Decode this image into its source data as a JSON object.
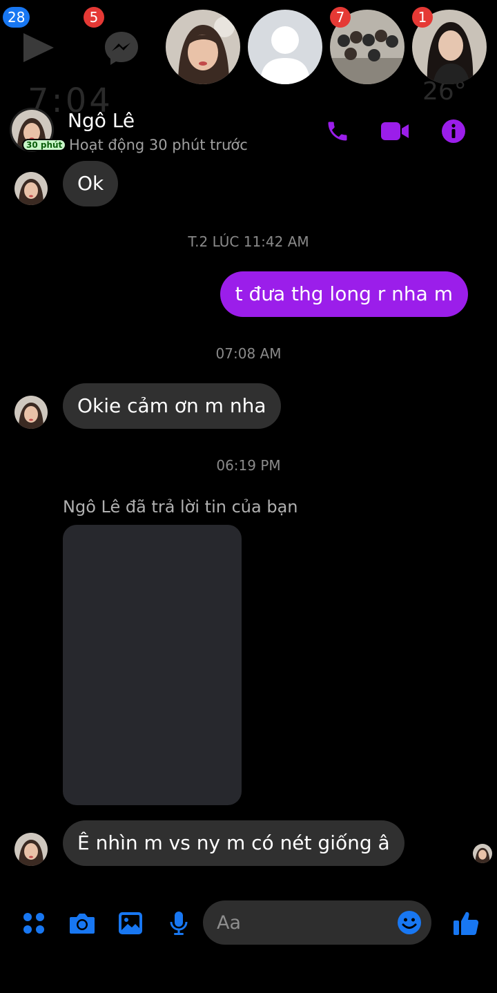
{
  "top_bar": {
    "badges": {
      "play": "28",
      "messenger": "5",
      "group": "7",
      "last": "1"
    },
    "ghost_time": "7:04",
    "ghost_temp": "26°"
  },
  "header": {
    "name": "Ngô Lê",
    "status": "Hoạt động 30 phút trước",
    "active_pill": "30 phút"
  },
  "messages": [
    {
      "type": "in",
      "text": "Ok"
    },
    {
      "type": "time",
      "text": "T.2 LÚC 11:42 AM"
    },
    {
      "type": "out",
      "text": "t đưa thg long r nha m"
    },
    {
      "type": "time",
      "text": "07:08 AM"
    },
    {
      "type": "in",
      "text": "Okie cảm ơn m nha"
    },
    {
      "type": "time",
      "text": "06:19 PM"
    },
    {
      "type": "reply_note",
      "text": "Ngô Lê đã trả lời tin của bạn"
    },
    {
      "type": "in",
      "text": "Ê nhìn m vs ny m có nét giống â"
    }
  ],
  "composer": {
    "placeholder": "Aa"
  },
  "colors": {
    "accent": "#9b1eea",
    "blue": "#1877f2",
    "bubble_in": "#303030",
    "badge_red": "#e53935"
  },
  "icons": [
    "play-icon",
    "messenger-icon",
    "phone-icon",
    "video-icon",
    "info-icon",
    "apps-icon",
    "camera-icon",
    "gallery-icon",
    "mic-icon",
    "emoji-icon",
    "like-icon"
  ]
}
